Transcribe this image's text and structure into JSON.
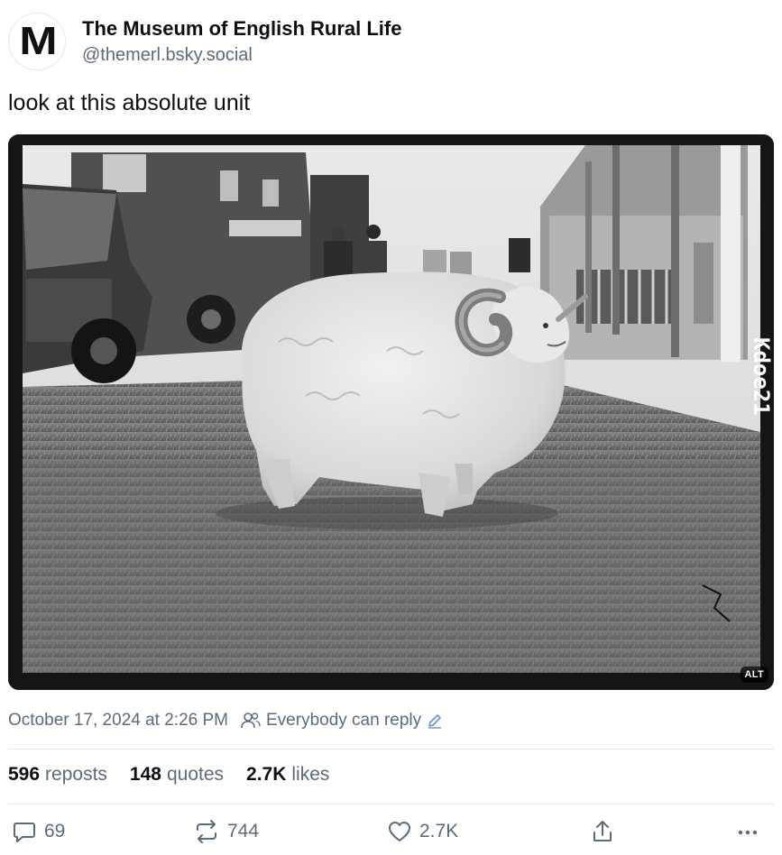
{
  "author": {
    "display_name": "The Museum of English Rural Life",
    "handle": "@themerl.bsky.social",
    "avatar_letter": "M"
  },
  "post": {
    "text": "look at this absolute unit",
    "image_alt_badge": "ALT",
    "photo_annotation": "Kdoe21",
    "date": "October 17, 2024 at 2:26 PM",
    "reply_setting": "Everybody can reply"
  },
  "stats": {
    "reposts_value": "596",
    "reposts_label": "reposts",
    "quotes_value": "148",
    "quotes_label": "quotes",
    "likes_value": "2.7K",
    "likes_label": "likes"
  },
  "actions": {
    "reply_count": "69",
    "repost_count": "744",
    "like_count": "2.7K"
  },
  "colors": {
    "text_primary": "#0b0f14",
    "text_secondary": "#5b6b7c",
    "divider": "#e4e7eb"
  },
  "icons": {
    "reply": "speech-bubble-icon",
    "repost": "repost-arrows-icon",
    "like": "heart-icon",
    "share": "share-icon",
    "more": "ellipsis-icon",
    "reply_setting": "people-icon",
    "edit": "pencil-icon"
  }
}
